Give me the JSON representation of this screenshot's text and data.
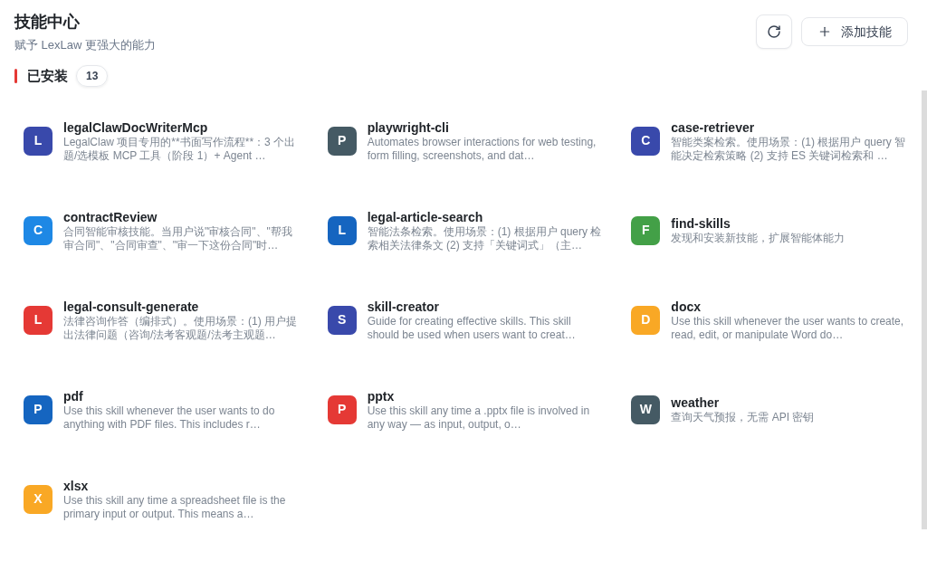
{
  "header": {
    "title": "技能中心",
    "subtitle": "赋予 LexLaw 更强大的能力",
    "add_button": {
      "label": "添加技能"
    }
  },
  "section": {
    "title": "已安装",
    "count": "13"
  },
  "skills": [
    {
      "initial": "L",
      "color": "#3949ab",
      "name": "legalClawDocWriterMcp",
      "description": "LegalClaw 项目专用的**书面写作流程**：3 个出题/选模板 MCP 工具（阶段 1）+ Agent …"
    },
    {
      "initial": "P",
      "color": "#455a64",
      "name": "playwright-cli",
      "description": "Automates browser interactions for web testing, form filling, screenshots, and dat…"
    },
    {
      "initial": "C",
      "color": "#3949ab",
      "name": "case-retriever",
      "description": "智能类案检索。使用场景：(1) 根据用户 query 智能决定检索策略 (2) 支持 ES 关键词检索和 …"
    },
    {
      "initial": "C",
      "color": "#1e88e5",
      "name": "contractReview",
      "description": "合同智能审核技能。当用户说\"审核合同\"、\"帮我审合同\"、\"合同审查\"、\"审一下这份合同\"时…"
    },
    {
      "initial": "L",
      "color": "#1565c0",
      "name": "legal-article-search",
      "description": "智能法条检索。使用场景：(1) 根据用户 query 检索相关法律条文 (2) 支持「关键词式」（主…"
    },
    {
      "initial": "F",
      "color": "#43a047",
      "name": "find-skills",
      "description": "发现和安装新技能，扩展智能体能力"
    },
    {
      "initial": "L",
      "color": "#e53935",
      "name": "legal-consult-generate",
      "description": "法律咨询作答（编排式）。使用场景：(1) 用户提出法律问题（咨询/法考客观题/法考主观题…"
    },
    {
      "initial": "S",
      "color": "#3949ab",
      "name": "skill-creator",
      "description": "Guide for creating effective skills. This skill should be used when users want to creat…"
    },
    {
      "initial": "D",
      "color": "#f9a825",
      "name": "docx",
      "description": "Use this skill whenever the user wants to create, read, edit, or manipulate Word do…"
    },
    {
      "initial": "P",
      "color": "#1565c0",
      "name": "pdf",
      "description": "Use this skill whenever the user wants to do anything with PDF files. This includes r…"
    },
    {
      "initial": "P",
      "color": "#e53935",
      "name": "pptx",
      "description": "Use this skill any time a .pptx file is involved in any way — as input, output, o…"
    },
    {
      "initial": "W",
      "color": "#455a64",
      "name": "weather",
      "description": "查询天气预报，无需 API 密钥"
    },
    {
      "initial": "X",
      "color": "#f9a825",
      "name": "xlsx",
      "description": "Use this skill any time a spreadsheet file is the primary input or output. This means a…"
    }
  ]
}
